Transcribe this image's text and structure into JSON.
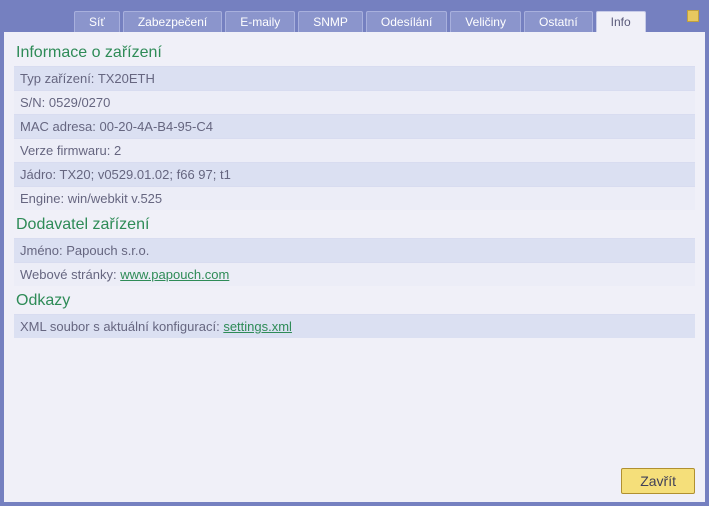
{
  "tabs": [
    {
      "label": "Síť",
      "active": false
    },
    {
      "label": "Zabezpečení",
      "active": false
    },
    {
      "label": "E-maily",
      "active": false
    },
    {
      "label": "SNMP",
      "active": false
    },
    {
      "label": "Odesílání",
      "active": false
    },
    {
      "label": "Veličiny",
      "active": false
    },
    {
      "label": "Ostatní",
      "active": false
    },
    {
      "label": "Info",
      "active": true
    }
  ],
  "sections": {
    "device_info": {
      "title": "Informace o zařízení",
      "rows": [
        {
          "label": "Typ zařízení:",
          "value": "TX20ETH"
        },
        {
          "label": "S/N:",
          "value": "0529/0270"
        },
        {
          "label": "MAC adresa:",
          "value": "00-20-4A-B4-95-C4"
        },
        {
          "label": "Verze firmwaru:",
          "value": "2"
        },
        {
          "label": "Jádro:",
          "value": "TX20; v0529.01.02; f66 97; t1"
        },
        {
          "label": "Engine:",
          "value": "win/webkit v.525"
        }
      ]
    },
    "vendor": {
      "title": "Dodavatel zařízení",
      "name_label": "Jméno:",
      "name_value": "Papouch s.r.o.",
      "web_label": "Webové stránky:",
      "web_link": "www.papouch.com"
    },
    "links": {
      "title": "Odkazy",
      "xml_label": "XML soubor s aktuální konfigurací:",
      "xml_link": "settings.xml"
    }
  },
  "footer": {
    "close_label": "Zavřít"
  }
}
